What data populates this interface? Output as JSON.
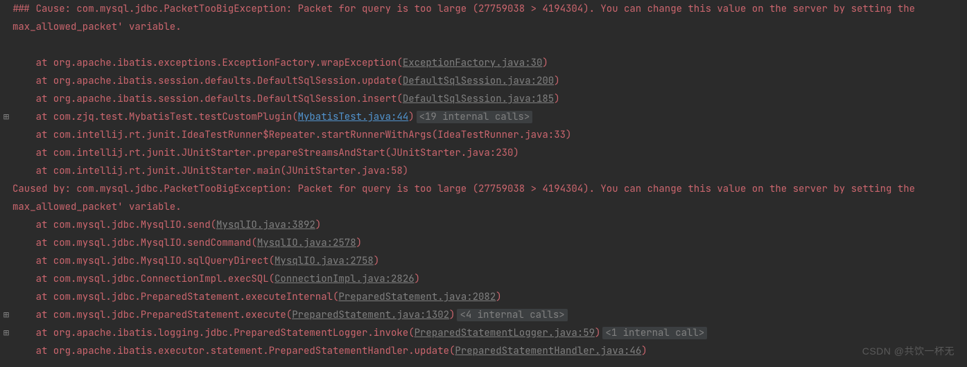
{
  "lines": [
    {
      "gutter": "",
      "interactable_gutter": false,
      "parts": [
        {
          "kind": "err",
          "text": "### Cause: com.mysql.jdbc.PacketTooBigException: Packet for query is too large (27759038 > 4194304). You can change this value on the server by setting the max_allowed_packet' variable."
        }
      ]
    },
    {
      "gutter": "",
      "interactable_gutter": false,
      "parts": [
        {
          "kind": "plain",
          "text": " "
        }
      ]
    },
    {
      "gutter": "",
      "interactable_gutter": false,
      "parts": [
        {
          "kind": "at",
          "text": "    at org.apache.ibatis.exceptions.ExceptionFactory.wrapException("
        },
        {
          "kind": "link",
          "text": "ExceptionFactory.java:30"
        },
        {
          "kind": "paren",
          "text": ")"
        }
      ]
    },
    {
      "gutter": "",
      "interactable_gutter": false,
      "parts": [
        {
          "kind": "at",
          "text": "    at org.apache.ibatis.session.defaults.DefaultSqlSession.update("
        },
        {
          "kind": "link",
          "text": "DefaultSqlSession.java:200"
        },
        {
          "kind": "paren",
          "text": ")"
        }
      ]
    },
    {
      "gutter": "",
      "interactable_gutter": false,
      "parts": [
        {
          "kind": "at",
          "text": "    at org.apache.ibatis.session.defaults.DefaultSqlSession.insert("
        },
        {
          "kind": "link",
          "text": "DefaultSqlSession.java:185"
        },
        {
          "kind": "paren",
          "text": ")"
        }
      ]
    },
    {
      "gutter": "⊞",
      "interactable_gutter": true,
      "parts": [
        {
          "kind": "at",
          "text": "    at com.zjq.test.MybatisTest.testCustomPlugin("
        },
        {
          "kind": "linkblue",
          "text": "MybatisTest.java:44"
        },
        {
          "kind": "paren",
          "text": ")"
        },
        {
          "kind": "tag",
          "text": "<19 internal calls>"
        }
      ]
    },
    {
      "gutter": "",
      "interactable_gutter": false,
      "parts": [
        {
          "kind": "at",
          "text": "    at com.intellij.rt.junit.IdeaTestRunner$Repeater.startRunnerWithArgs(IdeaTestRunner.java:33)"
        }
      ]
    },
    {
      "gutter": "",
      "interactable_gutter": false,
      "parts": [
        {
          "kind": "at",
          "text": "    at com.intellij.rt.junit.JUnitStarter.prepareStreamsAndStart(JUnitStarter.java:230)"
        }
      ]
    },
    {
      "gutter": "",
      "interactable_gutter": false,
      "parts": [
        {
          "kind": "at",
          "text": "    at com.intellij.rt.junit.JUnitStarter.main(JUnitStarter.java:58)"
        }
      ]
    },
    {
      "gutter": "",
      "interactable_gutter": false,
      "parts": [
        {
          "kind": "caused",
          "text": "Caused by: com.mysql.jdbc.PacketTooBigException: Packet for query is too large (27759038 > 4194304). You can change this value on the server by setting the max_allowed_packet' variable."
        }
      ]
    },
    {
      "gutter": "",
      "interactable_gutter": false,
      "parts": [
        {
          "kind": "at",
          "text": "    at com.mysql.jdbc.MysqlIO.send("
        },
        {
          "kind": "link",
          "text": "MysqlIO.java:3892"
        },
        {
          "kind": "paren",
          "text": ")"
        }
      ]
    },
    {
      "gutter": "",
      "interactable_gutter": false,
      "parts": [
        {
          "kind": "at",
          "text": "    at com.mysql.jdbc.MysqlIO.sendCommand("
        },
        {
          "kind": "link",
          "text": "MysqlIO.java:2578"
        },
        {
          "kind": "paren",
          "text": ")"
        }
      ]
    },
    {
      "gutter": "",
      "interactable_gutter": false,
      "parts": [
        {
          "kind": "at",
          "text": "    at com.mysql.jdbc.MysqlIO.sqlQueryDirect("
        },
        {
          "kind": "link",
          "text": "MysqlIO.java:2758"
        },
        {
          "kind": "paren",
          "text": ")"
        }
      ]
    },
    {
      "gutter": "",
      "interactable_gutter": false,
      "parts": [
        {
          "kind": "at",
          "text": "    at com.mysql.jdbc.ConnectionImpl.execSQL("
        },
        {
          "kind": "link",
          "text": "ConnectionImpl.java:2826"
        },
        {
          "kind": "paren",
          "text": ")"
        }
      ]
    },
    {
      "gutter": "",
      "interactable_gutter": false,
      "parts": [
        {
          "kind": "at",
          "text": "    at com.mysql.jdbc.PreparedStatement.executeInternal("
        },
        {
          "kind": "link",
          "text": "PreparedStatement.java:2082"
        },
        {
          "kind": "paren",
          "text": ")"
        }
      ]
    },
    {
      "gutter": "⊞",
      "interactable_gutter": true,
      "parts": [
        {
          "kind": "at",
          "text": "    at com.mysql.jdbc.PreparedStatement.execute("
        },
        {
          "kind": "link",
          "text": "PreparedStatement.java:1302"
        },
        {
          "kind": "paren",
          "text": ")"
        },
        {
          "kind": "tag",
          "text": "<4 internal calls>"
        }
      ]
    },
    {
      "gutter": "⊞",
      "interactable_gutter": true,
      "parts": [
        {
          "kind": "at",
          "text": "    at org.apache.ibatis.logging.jdbc.PreparedStatementLogger.invoke("
        },
        {
          "kind": "link",
          "text": "PreparedStatementLogger.java:59"
        },
        {
          "kind": "paren",
          "text": ")"
        },
        {
          "kind": "tag",
          "text": "<1 internal call>"
        }
      ]
    },
    {
      "gutter": "",
      "interactable_gutter": false,
      "parts": [
        {
          "kind": "at",
          "text": "    at org.apache.ibatis.executor.statement.PreparedStatementHandler.update("
        },
        {
          "kind": "link",
          "text": "PreparedStatementHandler.java:46"
        },
        {
          "kind": "paren",
          "text": ")"
        }
      ]
    }
  ],
  "watermark": "CSDN @共饮一杯无"
}
